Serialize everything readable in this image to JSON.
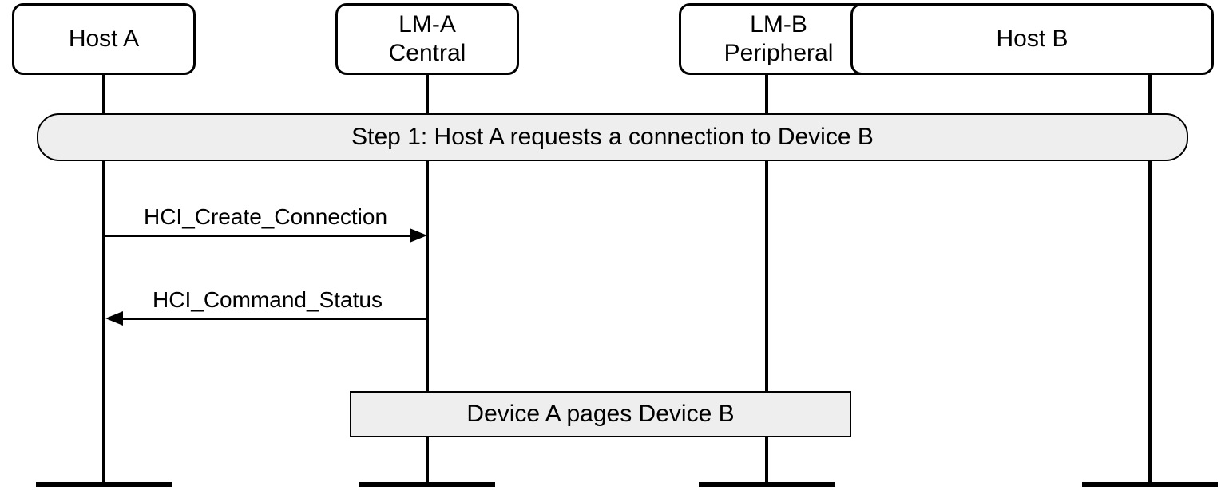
{
  "participants": {
    "host_a": {
      "label": "Host A"
    },
    "lm_a": {
      "line1": "LM-A",
      "line2": "Central"
    },
    "lm_b": {
      "line1": "LM-B",
      "line2": "Peripheral"
    },
    "host_b": {
      "label": "Host B"
    }
  },
  "step1": {
    "label": "Step 1:  Host A requests a connection to Device B"
  },
  "messages": {
    "m1": {
      "label": "HCI_Create_Connection",
      "from": "host_a",
      "to": "lm_a"
    },
    "m2": {
      "label": "HCI_Command_Status",
      "from": "lm_a",
      "to": "host_a"
    }
  },
  "note": {
    "label": "Device A pages Device B"
  }
}
